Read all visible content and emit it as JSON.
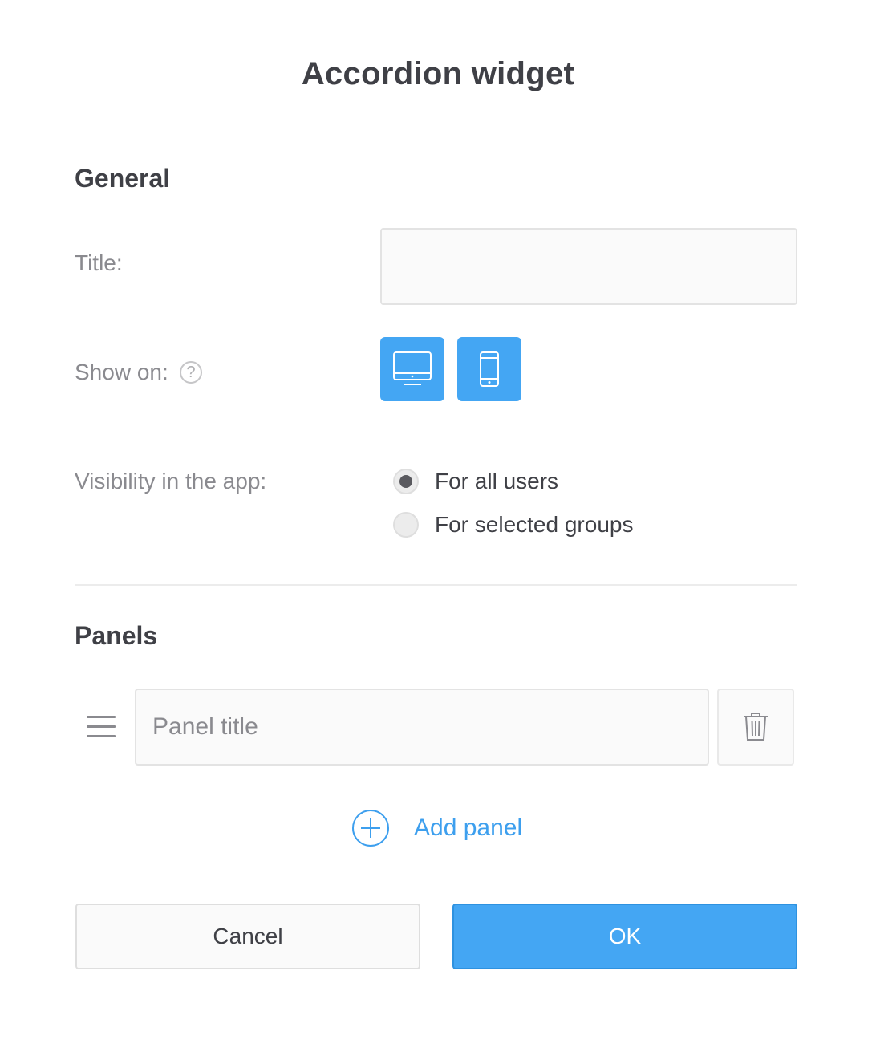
{
  "dialog": {
    "title": "Accordion widget"
  },
  "general": {
    "heading": "General",
    "title_label": "Title:",
    "title_value": "",
    "show_on_label": "Show on:",
    "help_glyph": "?",
    "devices": [
      {
        "name": "desktop",
        "icon": "desktop-icon",
        "selected": true
      },
      {
        "name": "mobile",
        "icon": "mobile-icon",
        "selected": true
      }
    ],
    "visibility_label": "Visibility in the app:",
    "visibility_options": [
      {
        "label": "For all users",
        "checked": true
      },
      {
        "label": "For selected groups",
        "checked": false
      }
    ]
  },
  "panels": {
    "heading": "Panels",
    "items": [
      {
        "placeholder": "Panel title",
        "value": ""
      }
    ],
    "add_label": "Add panel"
  },
  "footer": {
    "cancel_label": "Cancel",
    "ok_label": "OK"
  },
  "colors": {
    "accent": "#44a6f3",
    "link": "#3d9fee",
    "heading": "#3f4046",
    "label": "#8a8a8f"
  }
}
